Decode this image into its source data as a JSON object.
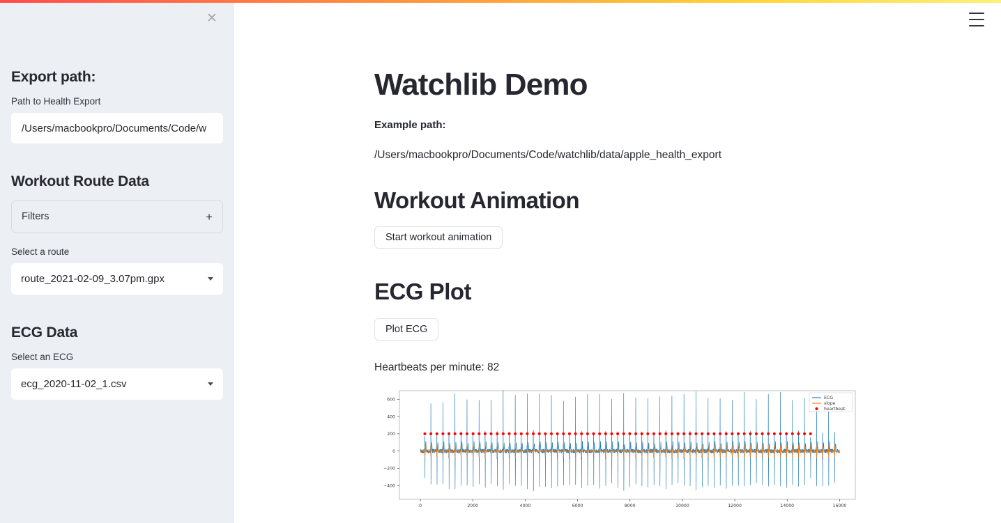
{
  "sidebar": {
    "close_icon": "close-icon",
    "export_heading": "Export path:",
    "path_label": "Path to Health Export",
    "path_value": "/Users/macbookpro/Documents/Code/w",
    "path_placeholder": "Path to Health Export",
    "route_heading": "Workout Route Data",
    "filters_label": "Filters",
    "filters_expand_icon": "plus-icon",
    "route_label": "Select a route",
    "route_value": "route_2021-02-09_3.07pm.gpx",
    "ecg_heading": "ECG Data",
    "ecg_label": "Select an ECG",
    "ecg_value": "ecg_2020-11-02_1.csv",
    "caret_icon": "chevron-down-icon"
  },
  "header": {
    "menu_icon": "hamburger-menu-icon"
  },
  "main": {
    "title": "Watchlib Demo",
    "example_path_label": "Example path:",
    "example_path_value": "/Users/macbookpro/Documents/Code/watchlib/data/apple_health_export",
    "workout_heading": "Workout Animation",
    "start_animation_button": "Start workout animation",
    "ecg_heading": "ECG Plot",
    "plot_ecg_button": "Plot ECG",
    "heartbeats_text": "Heartbeats per minute: 82"
  },
  "theme": {
    "accent_red": "#ff4b4b",
    "accent_yellow": "#fff07a",
    "sidebar_bg": "#eceff3",
    "text": "#262730",
    "ecg_line": "#1f77b4",
    "slope_line": "#ff7f0e",
    "heartbeat_dot": "#ff0000"
  },
  "chart_data": {
    "type": "line",
    "title": "",
    "xlabel": "",
    "ylabel": "",
    "xlim": [
      -800,
      16600
    ],
    "ylim": [
      -560,
      700
    ],
    "xticks": [
      0,
      2000,
      4000,
      6000,
      8000,
      10000,
      12000,
      14000,
      16000
    ],
    "yticks": [
      -400,
      -200,
      0,
      200,
      400,
      600
    ],
    "grid": false,
    "legend_position": "upper right",
    "legend": [
      {
        "name": "ECG",
        "color": "#1f77b4",
        "marker": "line"
      },
      {
        "name": "slope",
        "color": "#ff7f0e",
        "marker": "line"
      },
      {
        "name": "heartbeat",
        "color": "#ff0000",
        "marker": "dot"
      }
    ],
    "series": [
      {
        "name": "ECG",
        "color": "#1f77b4",
        "type": "line",
        "description": "Raw ECG voltage waveform, ~16000 samples, R-peaks reaching 450-700 and S-troughs down to -450"
      },
      {
        "name": "slope",
        "color": "#ff7f0e",
        "type": "line",
        "description": "Derivative / slope trace oscillating around 0 with spikes of +180 / -220 at each QRS complex"
      },
      {
        "name": "heartbeat",
        "color": "#ff0000",
        "type": "scatter",
        "description": "Detected heartbeat markers plotted at y = 200"
      }
    ],
    "heartbeat_y": 200,
    "heartbeat_count": 65,
    "beat_interval_samples": 230,
    "first_beat_x": 170,
    "r_peak_values": [
      480,
      560,
      600,
      575,
      660,
      690,
      620,
      600,
      640,
      575,
      640,
      600,
      655,
      690,
      620,
      640,
      600,
      680,
      700,
      640,
      620,
      660,
      600,
      580,
      640,
      620,
      675,
      640,
      600,
      660,
      620,
      600,
      640,
      690,
      620,
      600,
      650,
      620,
      600,
      640,
      660,
      620,
      600,
      640,
      620,
      675,
      640,
      600,
      660,
      620,
      640,
      600,
      620,
      660,
      640,
      600,
      620,
      640,
      600,
      660,
      620,
      600,
      640,
      620,
      470
    ]
  }
}
